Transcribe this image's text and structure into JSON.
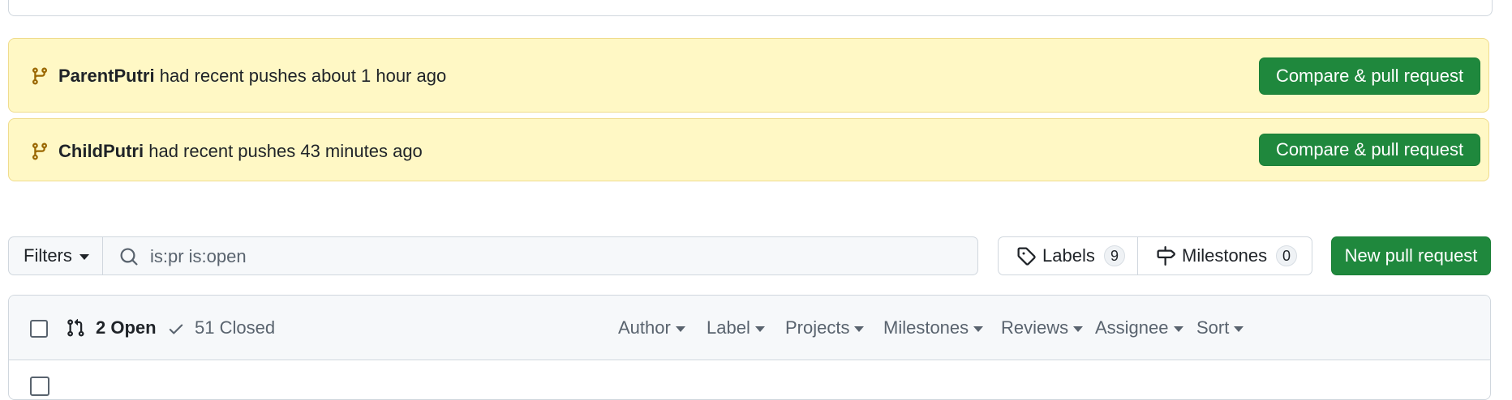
{
  "banners": [
    {
      "branch": "ParentPutri",
      "message": " had recent pushes about 1 hour ago",
      "button": "Compare & pull request"
    },
    {
      "branch": "ChildPutri",
      "message": " had recent pushes 43 minutes ago",
      "button": "Compare & pull request"
    }
  ],
  "toolbar": {
    "filters_label": "Filters",
    "search_value": "is:pr is:open",
    "labels_label": "Labels",
    "labels_count": "9",
    "milestones_label": "Milestones",
    "milestones_count": "0",
    "new_pr_label": "New pull request"
  },
  "list_header": {
    "open_label": "2 Open",
    "closed_label": "51 Closed",
    "filters": [
      "Author",
      "Label",
      "Projects",
      "Milestones",
      "Reviews",
      "Assignee",
      "Sort"
    ]
  },
  "colors": {
    "banner_bg": "#fff8c5",
    "primary_button": "#1f883d",
    "branch_icon": "#9a6700"
  },
  "icons": [
    "git-branch-icon",
    "search-icon",
    "tag-icon",
    "milestone-icon",
    "git-pull-request-icon",
    "check-icon",
    "caret-down-icon"
  ]
}
